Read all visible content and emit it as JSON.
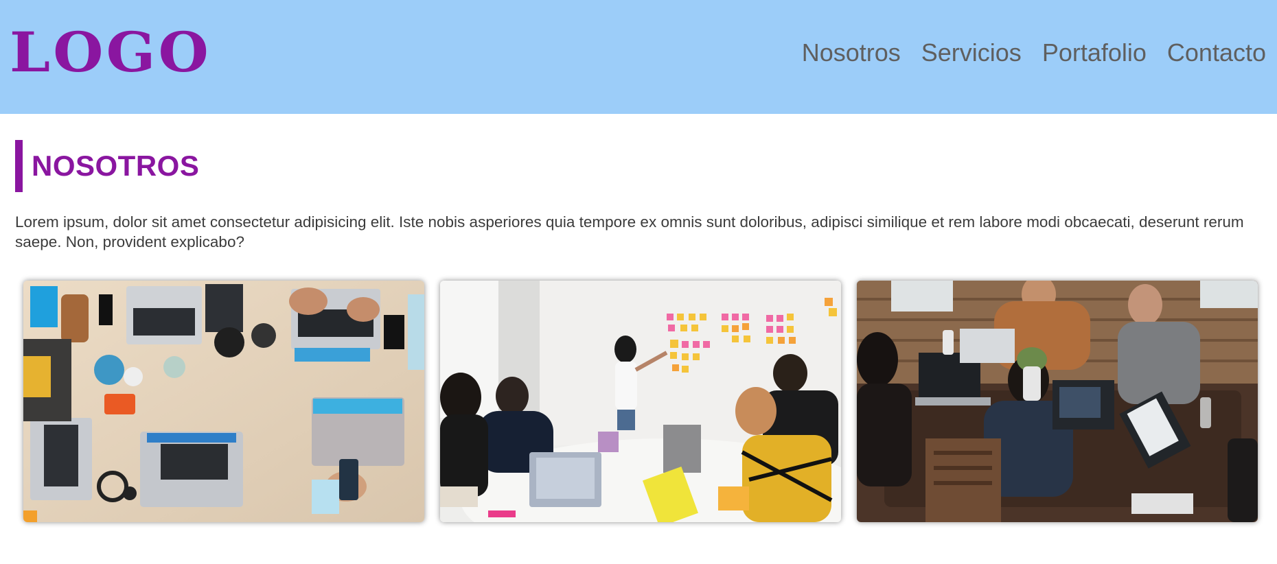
{
  "header": {
    "logo_text": "LOGO",
    "nav": [
      {
        "label": "Nosotros"
      },
      {
        "label": "Servicios"
      },
      {
        "label": "Portafolio"
      },
      {
        "label": "Contacto"
      }
    ]
  },
  "about": {
    "title": "NOSOTROS",
    "text": "Lorem ipsum, dolor sit amet consectetur adipisicing elit. Iste nobis asperiores quia tempore ex omnis sunt doloribus, adipisci similique et rem labore modi obcaecati, deserunt rerum saepe. Non, provident explicabo?"
  },
  "colors": {
    "header_bg": "#9ccdf9",
    "brand": "#8a16a0",
    "nav_text": "#5f5f5f",
    "body_text": "#3b3b3b"
  }
}
